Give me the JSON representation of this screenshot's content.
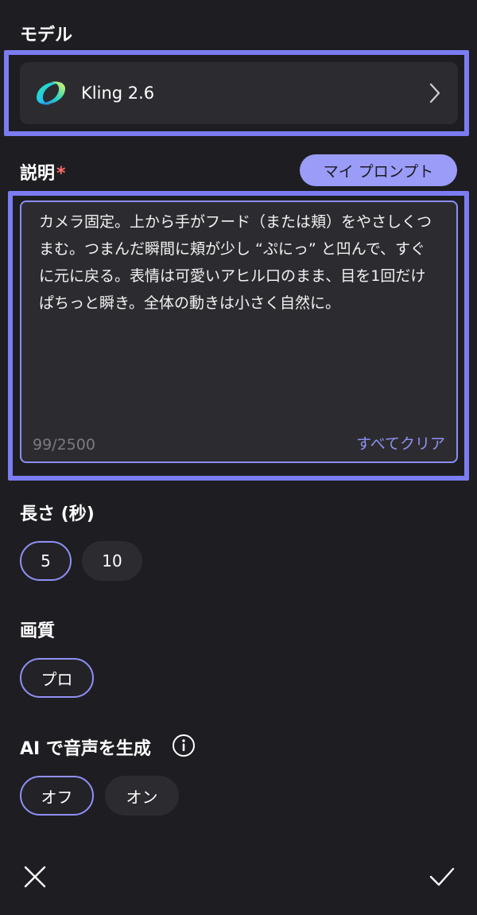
{
  "model_section": {
    "label": "モデル",
    "model_name": "Kling 2.6"
  },
  "description_section": {
    "label": "説明",
    "required_mark": "*",
    "my_prompt_button": "マイ プロンプト",
    "prompt_text": "カメラ固定。上から手がフード（または頬）をやさしくつまむ。つまんだ瞬間に頬が少し “ぷにっ” と凹んで、すぐに元に戻る。表情は可愛いアヒル口のまま、目を1回だけぱちっと瞬き。全体の動きは小さく自然に。",
    "char_count": "99/2500",
    "clear_all": "すべてクリア"
  },
  "duration_section": {
    "label": "長さ (秒)",
    "options": [
      {
        "label": "5",
        "selected": true
      },
      {
        "label": "10",
        "selected": false
      }
    ]
  },
  "quality_section": {
    "label": "画質",
    "options": [
      {
        "label": "プロ",
        "selected": true
      }
    ]
  },
  "audio_section": {
    "label": "AI で音声を生成",
    "options": [
      {
        "label": "オフ",
        "selected": true
      },
      {
        "label": "オン",
        "selected": false
      }
    ]
  },
  "colors": {
    "background": "#1e1e22",
    "card": "#2c2c30",
    "accent": "#8f90f5",
    "highlight": "#7b7cf2",
    "required": "#ff6b6b"
  },
  "icons": {
    "model_logo": "kling-logo-icon",
    "chevron": "chevron-right-icon",
    "info": "info-icon",
    "close": "close-icon",
    "confirm": "checkmark-icon"
  }
}
